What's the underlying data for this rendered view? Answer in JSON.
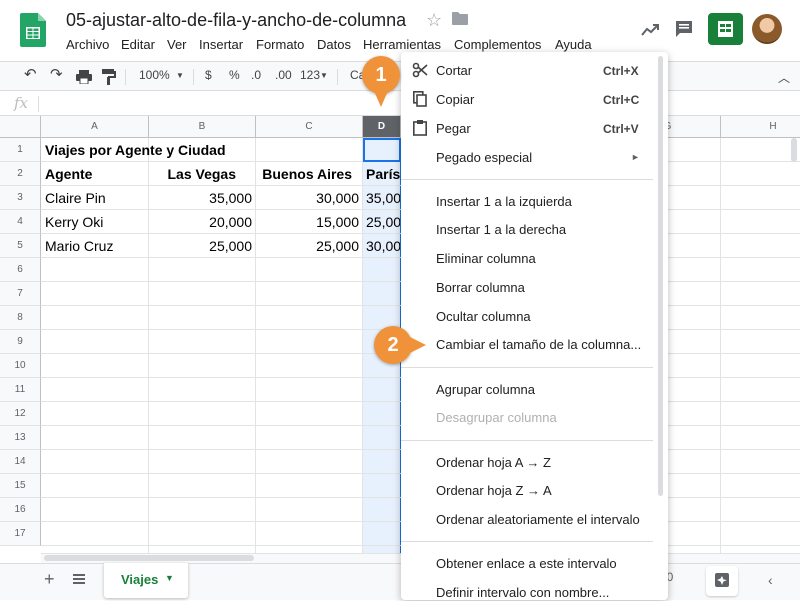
{
  "app": {
    "doc_title": "05-ajustar-alto-de-fila-y-ancho-de-columna",
    "menu": [
      "Archivo",
      "Editar",
      "Ver",
      "Insertar",
      "Formato",
      "Datos",
      "Herramientas",
      "Complementos",
      "Ayuda"
    ]
  },
  "toolbar": {
    "zoom": "100%",
    "currency": "$",
    "percent": "%",
    "decrease_decimals": ".0",
    "increase_decimals": ".00",
    "more_formats": "123",
    "font_stub": "Ca"
  },
  "formula": {
    "fx": "fx"
  },
  "columns": [
    "A",
    "B",
    "C",
    "D",
    "",
    "",
    "G",
    "H"
  ],
  "rows": [
    "1",
    "2",
    "3",
    "4",
    "5",
    "6",
    "7",
    "8",
    "9",
    "10",
    "11",
    "12",
    "13",
    "14",
    "15",
    "16",
    "17"
  ],
  "cells": {
    "title": "Viajes por Agente y Ciudad",
    "header": [
      "Agente",
      "Las Vegas",
      "Buenos Aires",
      "París"
    ],
    "data": [
      [
        "Claire Pin",
        "35,000",
        "30,000",
        "35,00"
      ],
      [
        "Kerry Oki",
        "20,000",
        "15,000",
        "25,00"
      ],
      [
        "Mario Cruz",
        "25,000",
        "25,000",
        "30,00"
      ]
    ]
  },
  "context_menu": {
    "cut": "Cortar",
    "cut_short": "Ctrl+X",
    "copy": "Copiar",
    "copy_short": "Ctrl+C",
    "paste": "Pegar",
    "paste_short": "Ctrl+V",
    "paste_special": "Pegado especial",
    "insert_left": "Insertar 1 a la izquierda",
    "insert_right": "Insertar 1 a la derecha",
    "delete_column": "Eliminar columna",
    "clear_column": "Borrar columna",
    "hide_column": "Ocultar columna",
    "resize_column": "Cambiar el tamaño de la columna...",
    "group_column": "Agrupar columna",
    "ungroup_column": "Desagrupar columna",
    "sort_az": "Ordenar hoja A → Z",
    "sort_za": "Ordenar hoja Z → A",
    "randomize": "Ordenar aleatoriamente el intervalo",
    "get_link": "Obtener enlace a este intervalo",
    "define_named_range": "Definir intervalo con nombre..."
  },
  "sheet": {
    "tab_label": "Viajes",
    "zoom_stub": "00"
  },
  "callouts": [
    "1",
    "2"
  ],
  "colors": {
    "accent": "#188038",
    "selection": "#1a73e8",
    "callout": "#f0923a"
  }
}
